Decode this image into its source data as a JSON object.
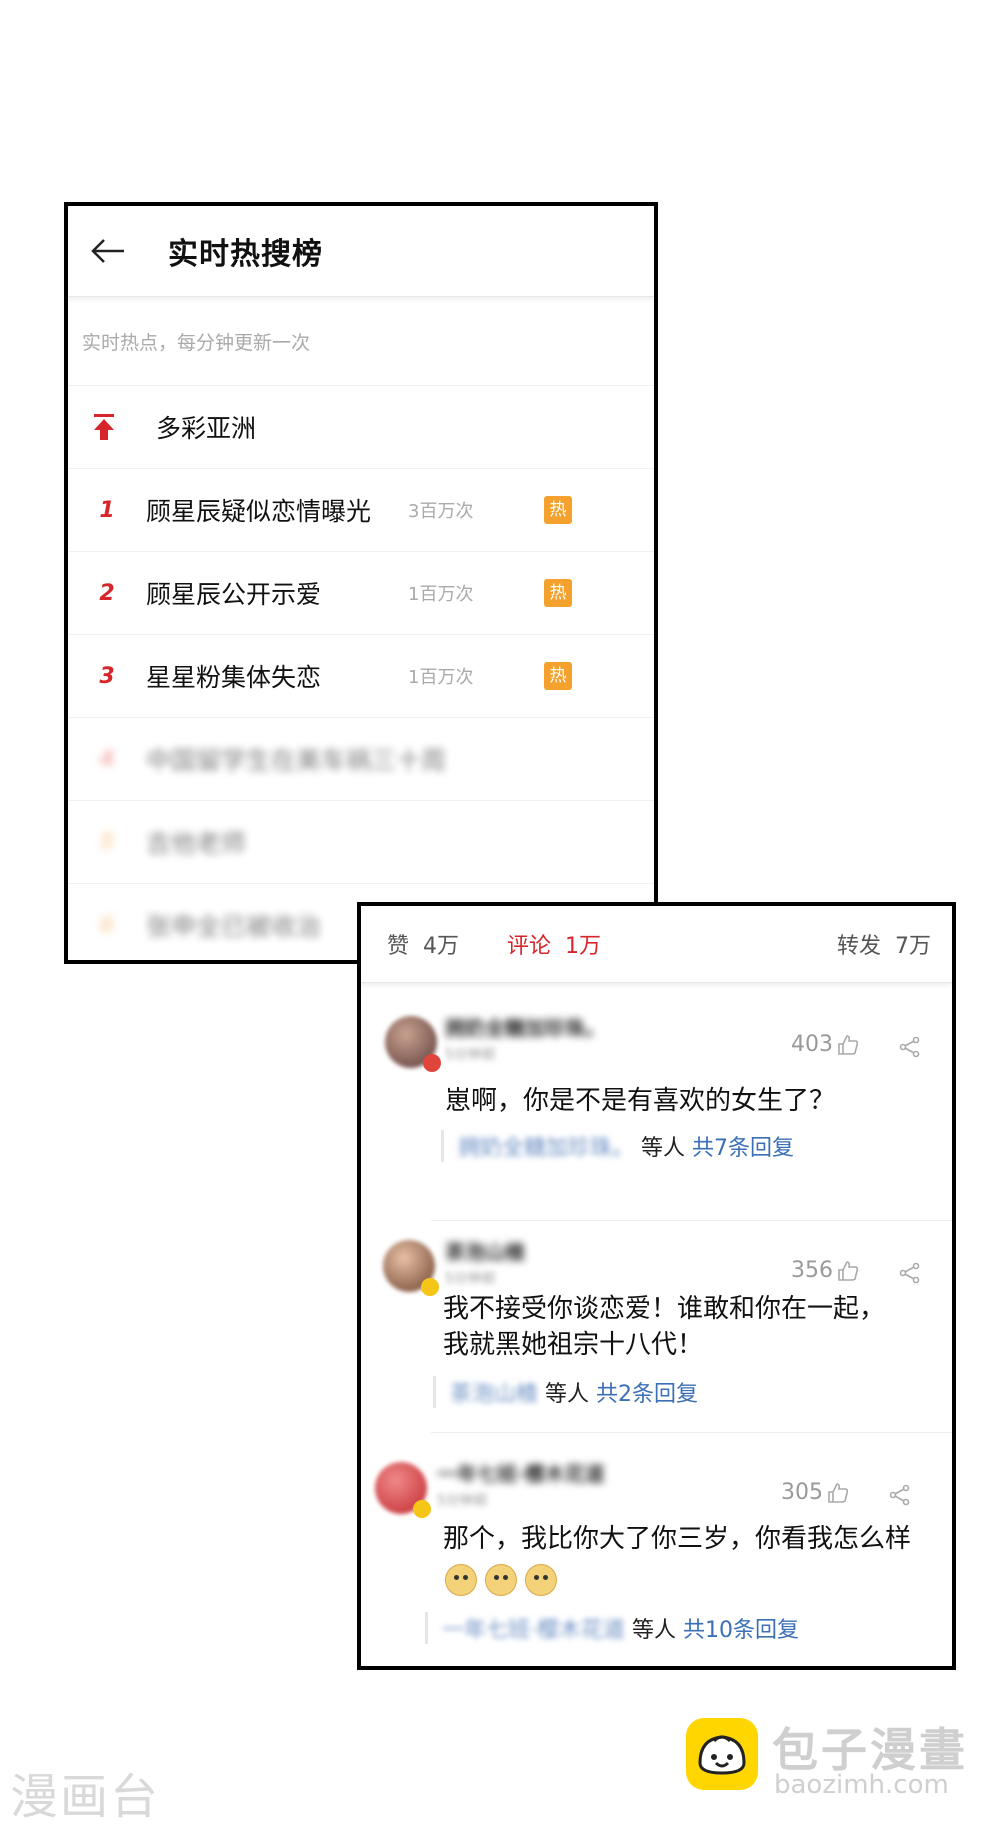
{
  "hot_search": {
    "title": "实时热搜榜",
    "subtitle": "实时热点，每分钟更新一次",
    "pinned": "多彩亚洲",
    "items": [
      {
        "rank": "1",
        "topic": "顾星辰疑似恋情曝光",
        "count": "3百万次",
        "badge": "热"
      },
      {
        "rank": "2",
        "topic": "顾星辰公开示爱",
        "count": "1百万次",
        "badge": "热"
      },
      {
        "rank": "3",
        "topic": "星星粉集体失恋",
        "count": "1百万次",
        "badge": "热"
      }
    ],
    "blurred": [
      {
        "rank": "4",
        "topic": "中国留学生在美车祸三十周"
      },
      {
        "rank": "5",
        "topic": "吉他老师"
      },
      {
        "rank": "6",
        "topic": "张申全已被收治"
      }
    ]
  },
  "comments_panel": {
    "tabs": {
      "likes_label": "赞",
      "likes_count": "4万",
      "comments_label": "评论",
      "comments_count": "1万",
      "reposts_label": "转发",
      "reposts_count": "7万"
    },
    "comments": [
      {
        "name": "拥奶全糖加珍珠。",
        "time": "5分钟前",
        "likes": "403",
        "text": "崽啊，你是不是有喜欢的女生了？",
        "reply_name": "拥奶全糖加珍珠。",
        "reply_mid": "等人",
        "reply_link": "共7条回复"
      },
      {
        "name": "茶泡山楂",
        "time": "5分钟前",
        "likes": "356",
        "text_line1": "我不接受你谈恋爱！谁敢和你在一起，",
        "text_line2": "我就黑她祖宗十八代！",
        "reply_name": "茶泡山楂",
        "reply_mid": "等人",
        "reply_link": "共2条回复"
      },
      {
        "name": "一年七班·樱木花道",
        "time": "5分钟前",
        "likes": "305",
        "text": "那个，我比你大了你三岁，你看我怎么样",
        "reply_name": "一年七班·樱木花道",
        "reply_mid": "等人",
        "reply_link": "共10条回复"
      }
    ]
  },
  "watermarks": {
    "left": "漫画台",
    "brand": "包子漫畫",
    "url": "baozimh.com"
  },
  "colors": {
    "accent_red": "#d7262b",
    "hot_badge": "#f4a12e",
    "link_blue": "#3b6fb6"
  }
}
